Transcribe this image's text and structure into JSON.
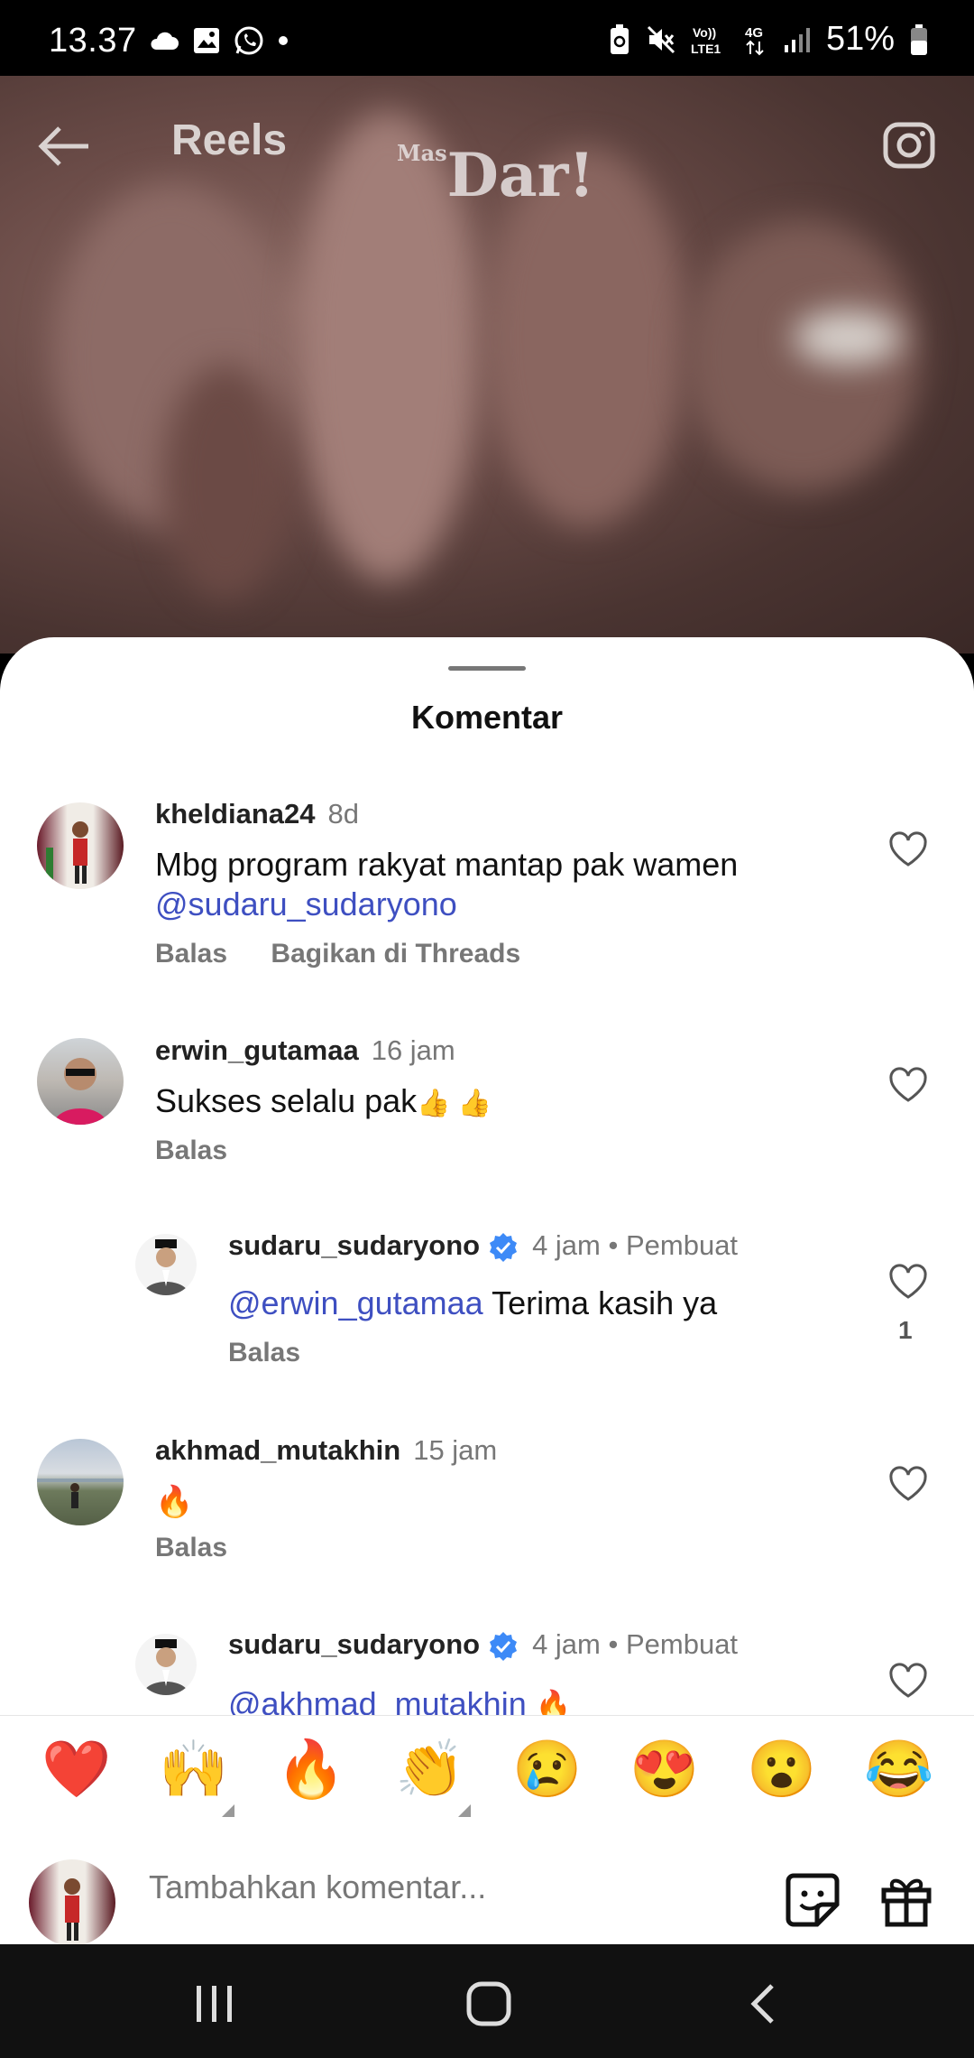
{
  "status_bar": {
    "time": "13.37",
    "battery": "51%",
    "network": "4G",
    "carrier_label": "VoLTE LTE1"
  },
  "top_bar": {
    "title": "Reels"
  },
  "video": {
    "watermark_small": "Mas",
    "watermark": "Dar!"
  },
  "sheet": {
    "title": "Komentar"
  },
  "comments": [
    {
      "user": "kheldiana24",
      "time": "8d",
      "text": "Mbg program rakyat mantap pak wamen",
      "mention": "@sudaru_sudaryono",
      "actions": [
        "Balas",
        "Bagikan di Threads"
      ]
    },
    {
      "user": "erwin_gutamaa",
      "time": "16 jam",
      "text": "Sukses selalu pak",
      "emoji": "👍 👍",
      "actions": [
        "Balas"
      ]
    },
    {
      "user": "sudaru_sudaryono",
      "time": "4 jam",
      "badge": "Pembuat",
      "mention": "@erwin_gutamaa",
      "text": "Terima  kasih ya",
      "likes": "1",
      "actions": [
        "Balas"
      ]
    },
    {
      "user": "akhmad_mutakhin",
      "time": "15 jam",
      "text": "🔥",
      "actions": [
        "Balas"
      ]
    },
    {
      "user": "sudaru_sudaryono",
      "time": "4 jam",
      "badge": "Pembuat",
      "mention": "@akhmad_mutakhin",
      "text": "🔥"
    }
  ],
  "reactions": [
    "❤️",
    "🙌",
    "🔥",
    "👏",
    "😢",
    "😍",
    "😮",
    "😂"
  ],
  "composer": {
    "placeholder": "Tambahkan komentar..."
  }
}
